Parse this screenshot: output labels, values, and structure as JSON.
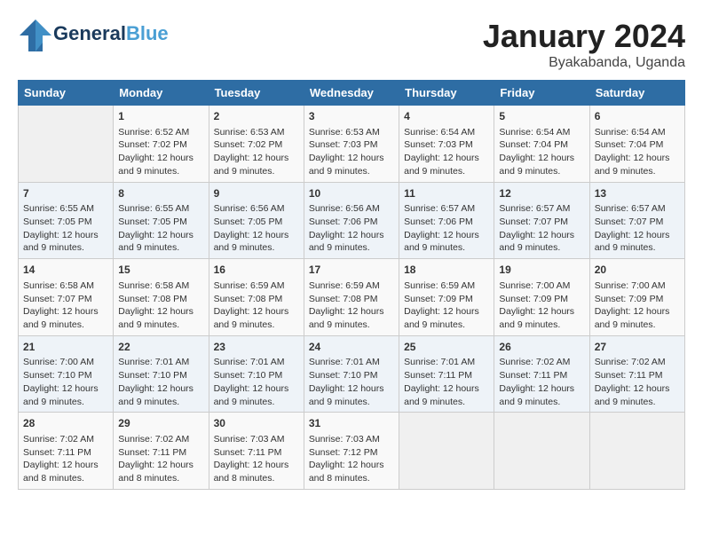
{
  "logo": {
    "line1": "General",
    "line2": "Blue"
  },
  "title": "January 2024",
  "subtitle": "Byakabanda, Uganda",
  "days_of_week": [
    "Sunday",
    "Monday",
    "Tuesday",
    "Wednesday",
    "Thursday",
    "Friday",
    "Saturday"
  ],
  "weeks": [
    [
      {
        "day": "",
        "info": ""
      },
      {
        "day": "1",
        "info": "Sunrise: 6:52 AM\nSunset: 7:02 PM\nDaylight: 12 hours and 9 minutes."
      },
      {
        "day": "2",
        "info": "Sunrise: 6:53 AM\nSunset: 7:02 PM\nDaylight: 12 hours and 9 minutes."
      },
      {
        "day": "3",
        "info": "Sunrise: 6:53 AM\nSunset: 7:03 PM\nDaylight: 12 hours and 9 minutes."
      },
      {
        "day": "4",
        "info": "Sunrise: 6:54 AM\nSunset: 7:03 PM\nDaylight: 12 hours and 9 minutes."
      },
      {
        "day": "5",
        "info": "Sunrise: 6:54 AM\nSunset: 7:04 PM\nDaylight: 12 hours and 9 minutes."
      },
      {
        "day": "6",
        "info": "Sunrise: 6:54 AM\nSunset: 7:04 PM\nDaylight: 12 hours and 9 minutes."
      }
    ],
    [
      {
        "day": "7",
        "info": "Sunrise: 6:55 AM\nSunset: 7:05 PM\nDaylight: 12 hours and 9 minutes."
      },
      {
        "day": "8",
        "info": "Sunrise: 6:55 AM\nSunset: 7:05 PM\nDaylight: 12 hours and 9 minutes."
      },
      {
        "day": "9",
        "info": "Sunrise: 6:56 AM\nSunset: 7:05 PM\nDaylight: 12 hours and 9 minutes."
      },
      {
        "day": "10",
        "info": "Sunrise: 6:56 AM\nSunset: 7:06 PM\nDaylight: 12 hours and 9 minutes."
      },
      {
        "day": "11",
        "info": "Sunrise: 6:57 AM\nSunset: 7:06 PM\nDaylight: 12 hours and 9 minutes."
      },
      {
        "day": "12",
        "info": "Sunrise: 6:57 AM\nSunset: 7:07 PM\nDaylight: 12 hours and 9 minutes."
      },
      {
        "day": "13",
        "info": "Sunrise: 6:57 AM\nSunset: 7:07 PM\nDaylight: 12 hours and 9 minutes."
      }
    ],
    [
      {
        "day": "14",
        "info": "Sunrise: 6:58 AM\nSunset: 7:07 PM\nDaylight: 12 hours and 9 minutes."
      },
      {
        "day": "15",
        "info": "Sunrise: 6:58 AM\nSunset: 7:08 PM\nDaylight: 12 hours and 9 minutes."
      },
      {
        "day": "16",
        "info": "Sunrise: 6:59 AM\nSunset: 7:08 PM\nDaylight: 12 hours and 9 minutes."
      },
      {
        "day": "17",
        "info": "Sunrise: 6:59 AM\nSunset: 7:08 PM\nDaylight: 12 hours and 9 minutes."
      },
      {
        "day": "18",
        "info": "Sunrise: 6:59 AM\nSunset: 7:09 PM\nDaylight: 12 hours and 9 minutes."
      },
      {
        "day": "19",
        "info": "Sunrise: 7:00 AM\nSunset: 7:09 PM\nDaylight: 12 hours and 9 minutes."
      },
      {
        "day": "20",
        "info": "Sunrise: 7:00 AM\nSunset: 7:09 PM\nDaylight: 12 hours and 9 minutes."
      }
    ],
    [
      {
        "day": "21",
        "info": "Sunrise: 7:00 AM\nSunset: 7:10 PM\nDaylight: 12 hours and 9 minutes."
      },
      {
        "day": "22",
        "info": "Sunrise: 7:01 AM\nSunset: 7:10 PM\nDaylight: 12 hours and 9 minutes."
      },
      {
        "day": "23",
        "info": "Sunrise: 7:01 AM\nSunset: 7:10 PM\nDaylight: 12 hours and 9 minutes."
      },
      {
        "day": "24",
        "info": "Sunrise: 7:01 AM\nSunset: 7:10 PM\nDaylight: 12 hours and 9 minutes."
      },
      {
        "day": "25",
        "info": "Sunrise: 7:01 AM\nSunset: 7:11 PM\nDaylight: 12 hours and 9 minutes."
      },
      {
        "day": "26",
        "info": "Sunrise: 7:02 AM\nSunset: 7:11 PM\nDaylight: 12 hours and 9 minutes."
      },
      {
        "day": "27",
        "info": "Sunrise: 7:02 AM\nSunset: 7:11 PM\nDaylight: 12 hours and 9 minutes."
      }
    ],
    [
      {
        "day": "28",
        "info": "Sunrise: 7:02 AM\nSunset: 7:11 PM\nDaylight: 12 hours and 8 minutes."
      },
      {
        "day": "29",
        "info": "Sunrise: 7:02 AM\nSunset: 7:11 PM\nDaylight: 12 hours and 8 minutes."
      },
      {
        "day": "30",
        "info": "Sunrise: 7:03 AM\nSunset: 7:11 PM\nDaylight: 12 hours and 8 minutes."
      },
      {
        "day": "31",
        "info": "Sunrise: 7:03 AM\nSunset: 7:12 PM\nDaylight: 12 hours and 8 minutes."
      },
      {
        "day": "",
        "info": ""
      },
      {
        "day": "",
        "info": ""
      },
      {
        "day": "",
        "info": ""
      }
    ]
  ]
}
